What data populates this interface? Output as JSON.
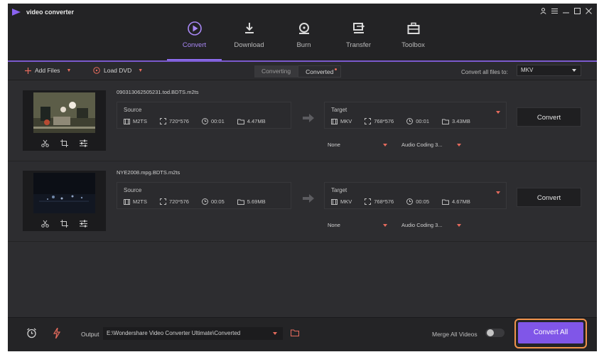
{
  "app": {
    "title": "video converter"
  },
  "nav": {
    "tabs": [
      {
        "label": "Convert",
        "icon": "convert-icon",
        "active": true
      },
      {
        "label": "Download",
        "icon": "download-icon",
        "active": false
      },
      {
        "label": "Burn",
        "icon": "disc-icon",
        "active": false
      },
      {
        "label": "Transfer",
        "icon": "transfer-icon",
        "active": false
      },
      {
        "label": "Toolbox",
        "icon": "toolbox-icon",
        "active": false
      }
    ]
  },
  "toolbar": {
    "add_files": "Add Files",
    "load_dvd": "Load DVD",
    "seg_converting": "Converting",
    "seg_converted": "Converted",
    "convert_all_to_label": "Convert all files to:",
    "format_value": "MKV"
  },
  "files": [
    {
      "name": "090313062505231.tod.BDTS.m2ts",
      "source": {
        "header": "Source",
        "format": "M2TS",
        "resolution": "720*576",
        "duration": "00:01",
        "size": "4.47MB"
      },
      "target": {
        "header": "Target",
        "format": "MKV",
        "resolution": "768*576",
        "duration": "00:01",
        "size": "3.43MB"
      },
      "subtitle": "None",
      "audio": "Audio Coding 3...",
      "convert_label": "Convert"
    },
    {
      "name": "NYE2008.mpg.BDTS.m2ts",
      "source": {
        "header": "Source",
        "format": "M2TS",
        "resolution": "720*576",
        "duration": "00:05",
        "size": "5.69MB"
      },
      "target": {
        "header": "Target",
        "format": "MKV",
        "resolution": "768*576",
        "duration": "00:05",
        "size": "4.67MB"
      },
      "subtitle": "None",
      "audio": "Audio Coding 3...",
      "convert_label": "Convert"
    }
  ],
  "bottom": {
    "output_label": "Output",
    "output_path": "E:\\Wondershare Video Converter Ultimate\\Converted",
    "merge_label": "Merge All Videos",
    "merge_on": false,
    "convert_all_label": "Convert All"
  },
  "colors": {
    "accent": "#8056e8",
    "highlight": "#f0934c",
    "caret": "#e56b5d"
  }
}
